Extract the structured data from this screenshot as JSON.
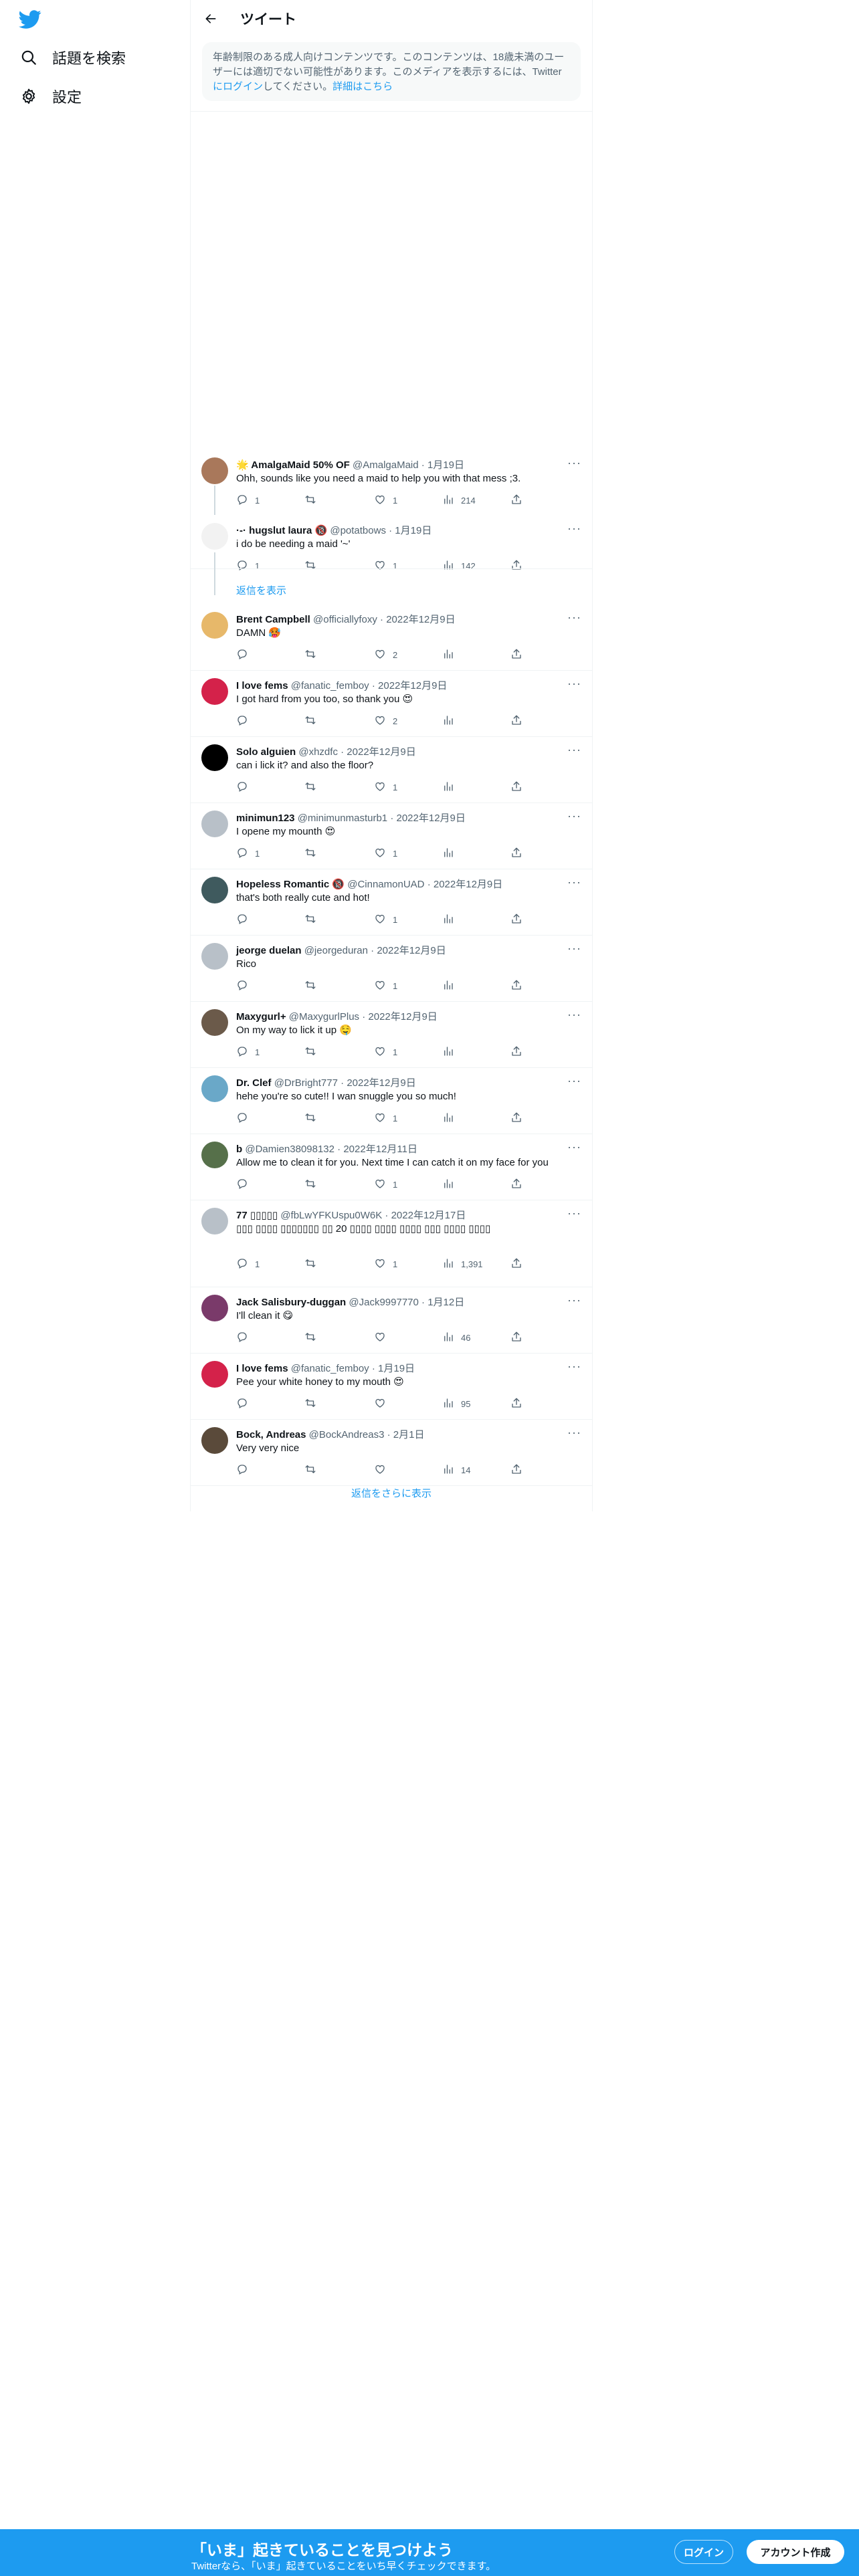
{
  "nav": {
    "explore_label": "話題を検索",
    "settings_label": "設定"
  },
  "header": {
    "title": "ツイート"
  },
  "warning": {
    "text": "年齢制限のある成人向けコンテンツです。このコンテンツは、18歳未満のユーザーには適切でない可能性があります。このメディアを表示するには、Twitter",
    "login_link": "にログイン",
    "text2": "してください。",
    "learn_more": "詳細はこちら"
  },
  "replies": [
    {
      "name": "🌟 AmalgaMaid 50% OF",
      "handle": "@AmalgaMaid",
      "date": "1月19日",
      "text": "Ohh, sounds like you need a maid to help you with that mess ;3.",
      "reply_count": "1",
      "retweet_count": "",
      "like_count": "1",
      "view_count": "214",
      "avatar_color": "#a9785b"
    },
    {
      "name": "·-· hugslut laura 🔞",
      "handle": "@potatbows",
      "date": "1月19日",
      "text": "i do be needing a maid '~'",
      "reply_count": "1",
      "retweet_count": "",
      "like_count": "1",
      "view_count": "142",
      "avatar_color": "#f2f2f2"
    },
    {
      "name": "Brent Campbell",
      "handle": "@officiallyfoxy",
      "date": "2022年12月9日",
      "text": "DAMN 🥵",
      "reply_count": "",
      "retweet_count": "",
      "like_count": "2",
      "view_count": "",
      "avatar_color": "#e7b86a"
    },
    {
      "name": "I love fems",
      "handle": "@fanatic_femboy",
      "date": "2022年12月9日",
      "text": "I got hard from you too, so thank you 😍",
      "reply_count": "",
      "retweet_count": "",
      "like_count": "2",
      "view_count": "",
      "avatar_color": "#d4224a"
    },
    {
      "name": "Solo alguien",
      "handle": "@xhzdfc",
      "date": "2022年12月9日",
      "text": "can i lick it? and also the floor?",
      "reply_count": "",
      "retweet_count": "",
      "like_count": "1",
      "view_count": "",
      "avatar_color": "#000000"
    },
    {
      "name": "minimun123",
      "handle": "@minimunmasturb1",
      "date": "2022年12月9日",
      "text": "I opene my mounth 😍",
      "reply_count": "1",
      "retweet_count": "",
      "like_count": "1",
      "view_count": "",
      "avatar_color": "#b8c0c8"
    },
    {
      "name": "Hopeless Romantic 🔞",
      "handle": "@CinnamonUAD",
      "date": "2022年12月9日",
      "text": "that's both really cute and hot!",
      "reply_count": "",
      "retweet_count": "",
      "like_count": "1",
      "view_count": "",
      "avatar_color": "#3f5a5e"
    },
    {
      "name": "jeorge duelan",
      "handle": "@jeorgeduran",
      "date": "2022年12月9日",
      "text": "Rico",
      "reply_count": "",
      "retweet_count": "",
      "like_count": "1",
      "view_count": "",
      "avatar_color": "#b8c0c8"
    },
    {
      "name": "Maxygurl+",
      "handle": "@MaxygurlPlus",
      "date": "2022年12月9日",
      "text": "On my way to lick it up 🤤",
      "reply_count": "1",
      "retweet_count": "",
      "like_count": "1",
      "view_count": "",
      "avatar_color": "#6b5a4a"
    },
    {
      "name": "Dr. Clef",
      "handle": "@DrBright777",
      "date": "2022年12月9日",
      "text": "hehe you're so cute!! I wan snuggle you so much!",
      "reply_count": "",
      "retweet_count": "",
      "like_count": "1",
      "view_count": "",
      "avatar_color": "#6aa8c8"
    },
    {
      "name": "b",
      "handle": "@Damien38098132",
      "date": "2022年12月11日",
      "text": "Allow me to clean it for you. Next time I can catch it on my face for you",
      "reply_count": "",
      "retweet_count": "",
      "like_count": "1",
      "view_count": "",
      "avatar_color": "#56704a"
    },
    {
      "name": "77 ▯▯▯▯▯",
      "handle": "@fbLwYFKUspu0W6K",
      "date": "2022年12月17日",
      "text": "▯▯▯ ▯▯▯▯ ▯▯▯▯▯▯▯ ▯▯ 20 ▯▯▯▯ ▯▯▯▯ ▯▯▯▯ ▯▯▯ ▯▯▯▯ ▯▯▯▯",
      "reply_count": "1",
      "retweet_count": "",
      "like_count": "1",
      "view_count": "1,391",
      "avatar_color": "#b8c0c8"
    },
    {
      "name": "Jack Salisbury-duggan",
      "handle": "@Jack9997770",
      "date": "1月12日",
      "text": "I'll clean it 😋",
      "reply_count": "",
      "retweet_count": "",
      "like_count": "",
      "view_count": "46",
      "avatar_color": "#7a3a6a"
    },
    {
      "name": "I love fems",
      "handle": "@fanatic_femboy",
      "date": "1月19日",
      "text": "Pee your white honey to my mouth 😍",
      "reply_count": "",
      "retweet_count": "",
      "like_count": "",
      "view_count": "95",
      "avatar_color": "#d4224a"
    },
    {
      "name": "Bock, Andreas",
      "handle": "@BockAndreas3",
      "date": "2月1日",
      "text": "Very very nice",
      "reply_count": "",
      "retweet_count": "",
      "like_count": "",
      "view_count": "14",
      "avatar_color": "#5a4a3a"
    }
  ],
  "thread": {
    "show_replies": "返信を表示"
  },
  "show_more": "返信をさらに表示",
  "bottom_bar": {
    "title": "「いま」起きていることを見つけよう",
    "subtitle": "Twitterなら、「いま」起きていることをいち早くチェックできます。",
    "login": "ログイン",
    "signup": "アカウント作成"
  },
  "colors": {
    "brand": "#1d9bf0",
    "text": "#0f1419",
    "muted": "#536471"
  }
}
